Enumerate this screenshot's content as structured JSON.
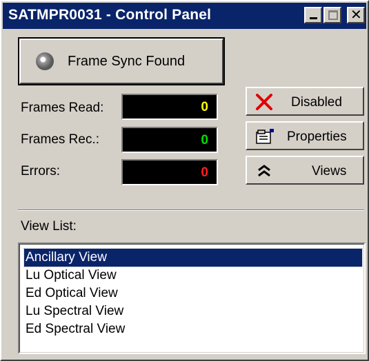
{
  "window": {
    "title": "SATMPR0031 - Control Panel",
    "titlebar_color": "#0a246a"
  },
  "titlebar_buttons": {
    "minimize_icon": "minimize-icon",
    "maximize_icon": "maximize-icon",
    "close_glyph": "✕"
  },
  "sync_status": {
    "label": "Frame Sync Found",
    "icon": "status-light-icon"
  },
  "counters": [
    {
      "label": "Frames Read:",
      "value": "0",
      "color": "#ffff00"
    },
    {
      "label": "Frames Rec.:",
      "value": "0",
      "color": "#00e000"
    },
    {
      "label": "Errors:",
      "value": "0",
      "color": "#ff2020"
    }
  ],
  "buttons": {
    "disabled": {
      "label": "Disabled",
      "icon": "red-x-icon"
    },
    "properties": {
      "label": "Properties",
      "icon": "properties-icon"
    },
    "views": {
      "label": "Views",
      "icon": "double-chevron-up-icon"
    }
  },
  "view_list": {
    "label": "View List:",
    "items": [
      "Ancillary View",
      "Lu Optical View",
      "Ed Optical View",
      "Lu Spectral View",
      "Ed Spectral View"
    ],
    "selected": "Ancillary View"
  }
}
